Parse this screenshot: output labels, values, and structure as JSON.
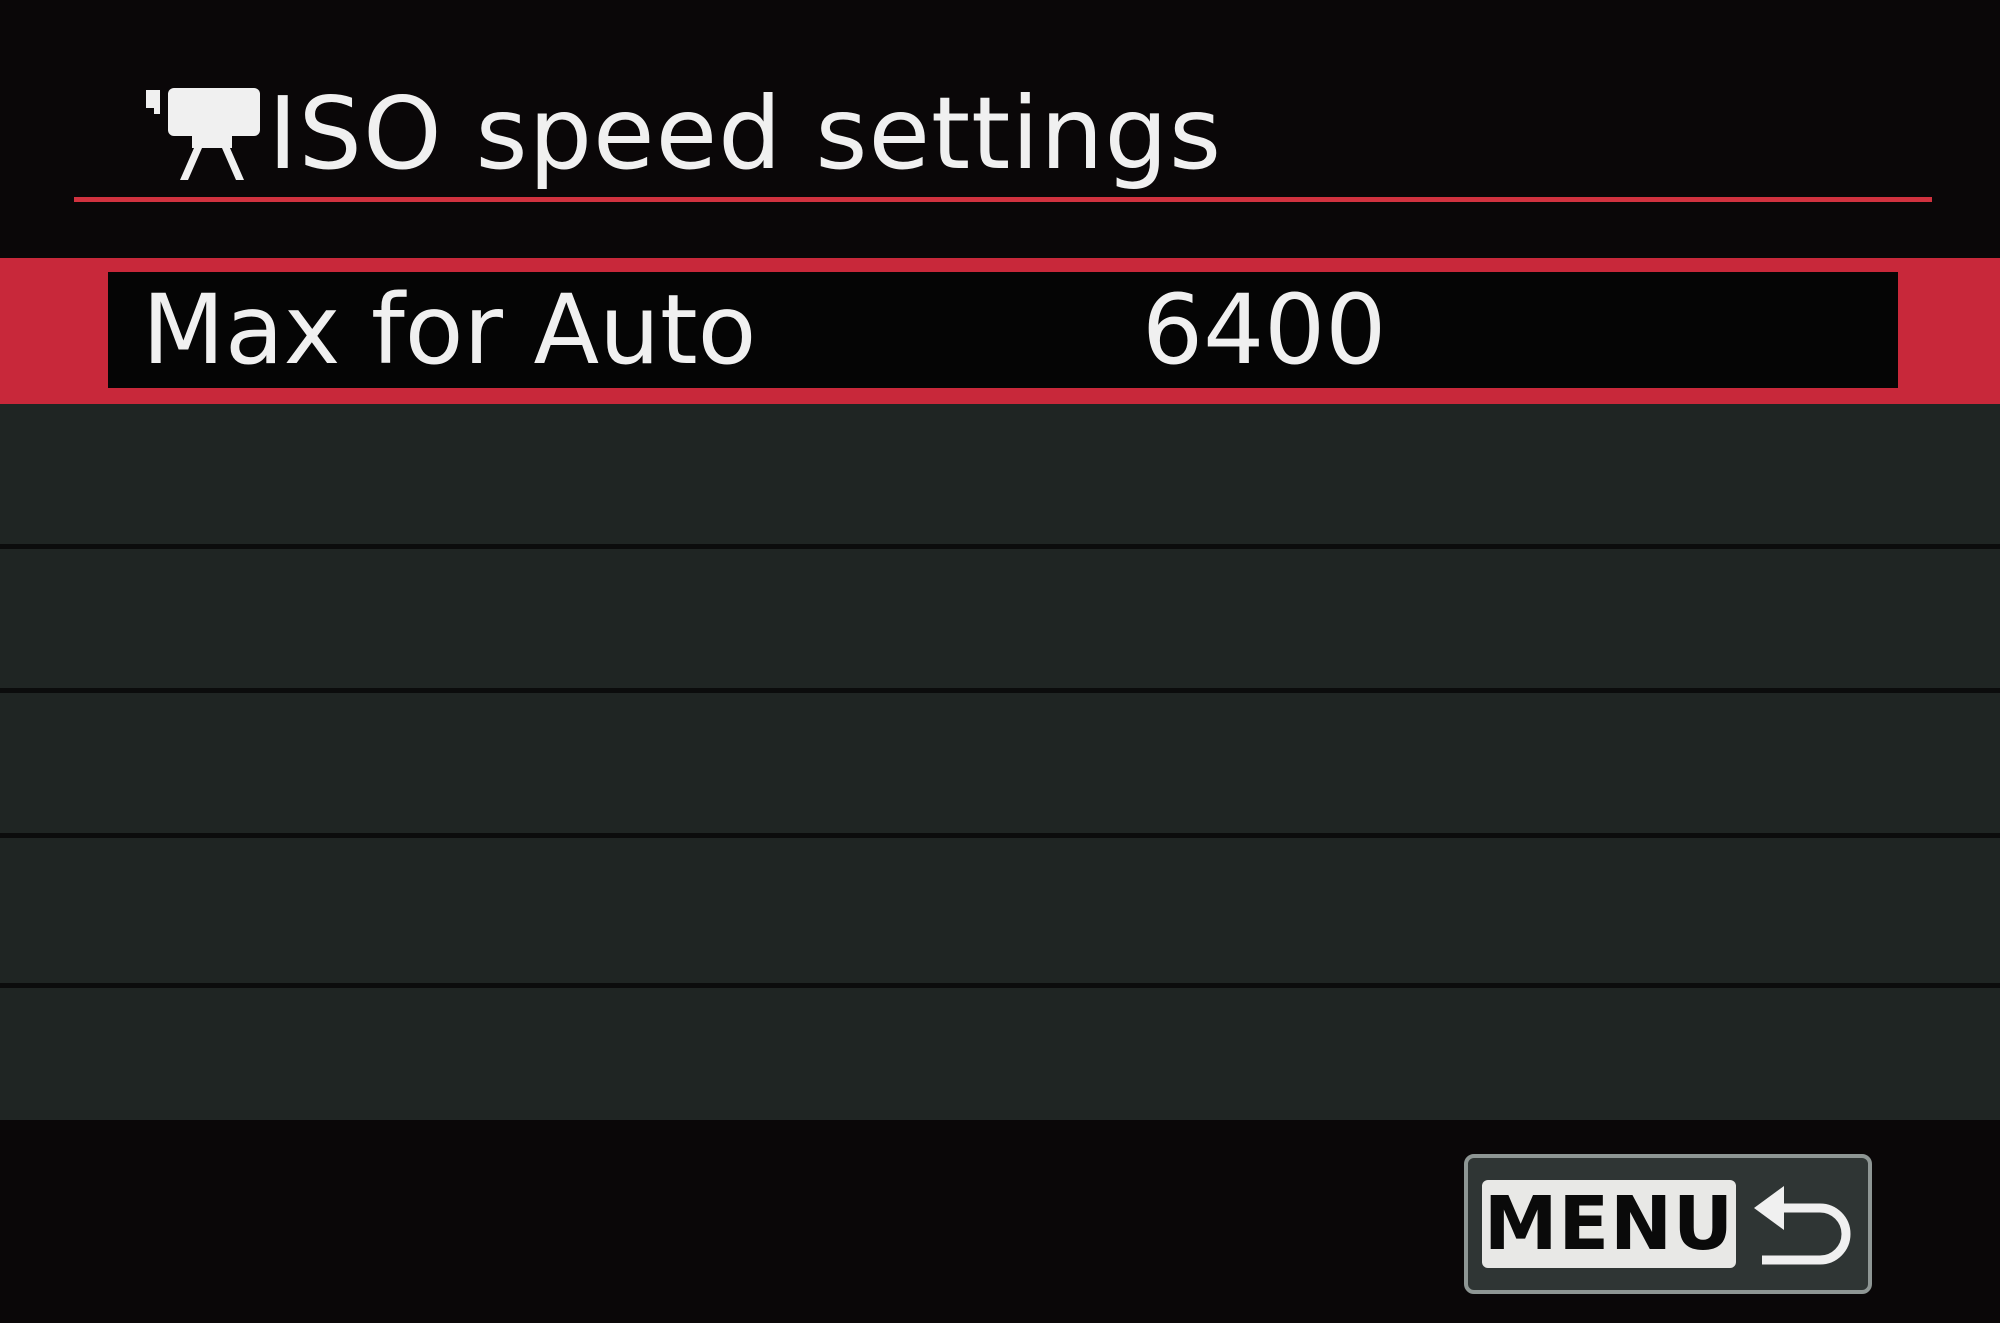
{
  "header": {
    "icon": "movie-camera-icon",
    "title": "ISO speed settings"
  },
  "menu": {
    "items": [
      {
        "label": "Max for Auto",
        "value": "6400",
        "selected": true
      },
      {
        "label": "",
        "value": ""
      },
      {
        "label": "",
        "value": ""
      },
      {
        "label": "",
        "value": ""
      },
      {
        "label": "",
        "value": ""
      }
    ]
  },
  "footer": {
    "menu_button_label": "MENU",
    "return_icon": "return-arrow-icon"
  },
  "colors": {
    "accent": "#c8283a",
    "background": "#0a0708",
    "row_background": "#1f2523",
    "text": "#f0f0f0"
  }
}
